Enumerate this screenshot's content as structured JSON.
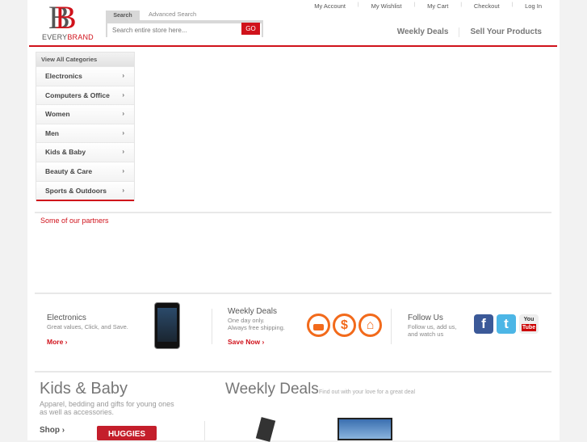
{
  "logo": {
    "mark": "B",
    "left": "EVERY",
    "right": "BRAND"
  },
  "search": {
    "tab": "Search",
    "advanced": "Advanced Search",
    "placeholder": "Search entire store here...",
    "go": "GO"
  },
  "toplinks": [
    "My Account",
    "My Wishlist",
    "My Cart",
    "Checkout",
    "Log In"
  ],
  "mainnav": [
    "Weekly Deals",
    "Sell Your Products"
  ],
  "categories": {
    "title": "View All Categories",
    "items": [
      "Electronics",
      "Computers & Office",
      "Women",
      "Men",
      "Kids & Baby",
      "Beauty & Care",
      "Sports & Outdoors"
    ],
    "chevron": "›"
  },
  "partners": "Some of our partners",
  "promo": {
    "electronics": {
      "title": "Electronics",
      "sub": "Great values, Click, and Save.",
      "link": "More ›"
    },
    "deals": {
      "title": "Weekly Deals",
      "sub1": "One day only.",
      "sub2": "Always free shipping.",
      "link": "Save Now ›",
      "icons": [
        "$",
        "⌂"
      ]
    },
    "follow": {
      "title": "Follow Us",
      "sub1": "Follow us, add us,",
      "sub2": "and watch us",
      "fb": "f",
      "tw": "t",
      "yt1": "You",
      "yt2": "Tube"
    }
  },
  "kids": {
    "title": "Kids & Baby",
    "sub1": "Apparel, bedding and gifts for young ones",
    "sub2": "as well as accessories.",
    "link": "Shop ›",
    "product": "HUGGIES"
  },
  "weekly": {
    "title": "Weekly Deals",
    "sub": "Find out with your love for a great deal"
  },
  "colors": {
    "accent": "#d0121b",
    "orange": "#f26a1b"
  }
}
